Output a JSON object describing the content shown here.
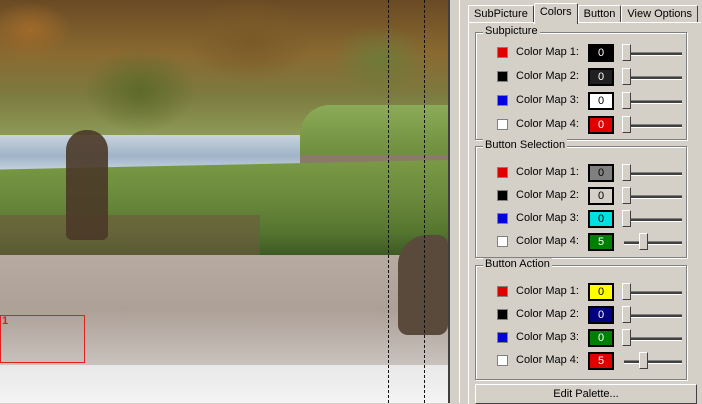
{
  "tabs": [
    "SubPicture",
    "Colors",
    "Button",
    "View Options"
  ],
  "active_tab": 1,
  "groups": [
    {
      "title": "Subpicture",
      "rows": [
        {
          "label": "Color Map 1:",
          "swatch": "#e00000",
          "value": "0",
          "value_bg": "#000000",
          "value_fg": "#ffffff",
          "slider": 0.0
        },
        {
          "label": "Color Map 2:",
          "swatch": "#000000",
          "value": "0",
          "value_bg": "#202020",
          "value_fg": "#ffffff",
          "slider": 0.0
        },
        {
          "label": "Color Map 3:",
          "swatch": "#0000e0",
          "value": "0",
          "value_bg": "#ffffff",
          "value_fg": "#000000",
          "slider": 0.0
        },
        {
          "label": "Color Map 4:",
          "swatch": "#ffffff",
          "value": "0",
          "value_bg": "#e00000",
          "value_fg": "#ffffff",
          "slider": 0.0
        }
      ]
    },
    {
      "title": "Button Selection",
      "rows": [
        {
          "label": "Color Map 1:",
          "swatch": "#e00000",
          "value": "0",
          "value_bg": "#808080",
          "value_fg": "#000000",
          "slider": 0.0
        },
        {
          "label": "Color Map 2:",
          "swatch": "#000000",
          "value": "0",
          "value_bg": "#d4d0c8",
          "value_fg": "#000000",
          "slider": 0.0
        },
        {
          "label": "Color Map 3:",
          "swatch": "#0000e0",
          "value": "0",
          "value_bg": "#00e0e0",
          "value_fg": "#000000",
          "slider": 0.0
        },
        {
          "label": "Color Map 4:",
          "swatch": "#ffffff",
          "value": "5",
          "value_bg": "#008000",
          "value_fg": "#ffffff",
          "slider": 0.33
        }
      ]
    },
    {
      "title": "Button Action",
      "rows": [
        {
          "label": "Color Map 1:",
          "swatch": "#e00000",
          "value": "0",
          "value_bg": "#ffff00",
          "value_fg": "#000000",
          "slider": 0.0
        },
        {
          "label": "Color Map 2:",
          "swatch": "#000000",
          "value": "0",
          "value_bg": "#000080",
          "value_fg": "#ffffff",
          "slider": 0.0
        },
        {
          "label": "Color Map 3:",
          "swatch": "#0000e0",
          "value": "0",
          "value_bg": "#008000",
          "value_fg": "#ffffff",
          "slider": 0.0
        },
        {
          "label": "Color Map 4:",
          "swatch": "#ffffff",
          "value": "5",
          "value_bg": "#e00000",
          "value_fg": "#ffffff",
          "slider": 0.33
        }
      ]
    }
  ],
  "edit_palette_label": "Edit Palette...",
  "preview": {
    "selection_number": "1",
    "selection_color": "#e02020"
  }
}
